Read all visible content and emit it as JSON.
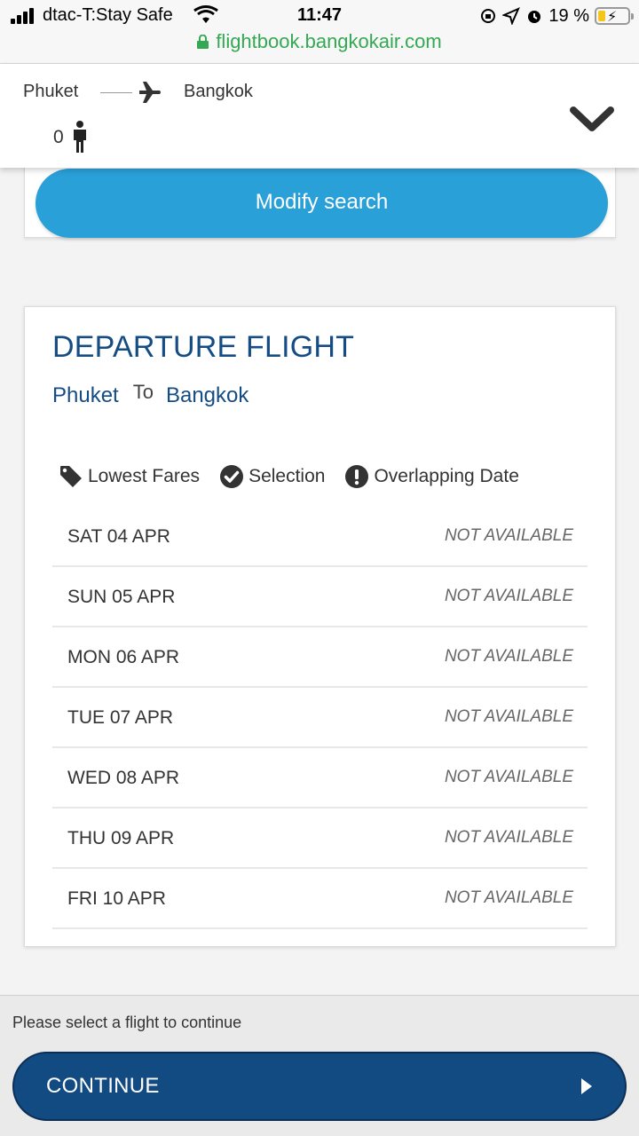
{
  "status_bar": {
    "carrier": "dtac-T:Stay Safe",
    "time": "11:47",
    "battery_percent": "19 %",
    "icons": [
      "signal-icon",
      "wifi-icon",
      "orientation-lock-icon",
      "location-icon",
      "alarm-icon",
      "battery-icon"
    ]
  },
  "browser": {
    "url": "flightbook.bangkokair.com"
  },
  "route_header": {
    "origin": "Phuket",
    "destination": "Bangkok",
    "passenger_count": "0"
  },
  "search": {
    "modify_label": "Modify search"
  },
  "departure": {
    "title": "DEPARTURE FLIGHT",
    "origin": "Phuket",
    "to_word": "To",
    "destination": "Bangkok",
    "legend": [
      {
        "icon": "tag-icon",
        "label": "Lowest Fares"
      },
      {
        "icon": "check-circle-icon",
        "label": "Selection"
      },
      {
        "icon": "exclamation-circle-icon",
        "label": "Overlapping Date"
      }
    ],
    "dates": [
      {
        "date": "SAT 04 APR",
        "status": "NOT AVAILABLE"
      },
      {
        "date": "SUN 05 APR",
        "status": "NOT AVAILABLE"
      },
      {
        "date": "MON 06 APR",
        "status": "NOT AVAILABLE"
      },
      {
        "date": "TUE 07 APR",
        "status": "NOT AVAILABLE"
      },
      {
        "date": "WED 08 APR",
        "status": "NOT AVAILABLE"
      },
      {
        "date": "THU 09 APR",
        "status": "NOT AVAILABLE"
      },
      {
        "date": "FRI 10 APR",
        "status": "NOT AVAILABLE"
      }
    ]
  },
  "footer": {
    "message": "Please select a flight to continue",
    "continue_label": "CONTINUE"
  },
  "colors": {
    "brand_navy": "#154c84",
    "button_blue": "#2aa0d8",
    "continue_navy": "#124a82",
    "url_green": "#34a853"
  }
}
